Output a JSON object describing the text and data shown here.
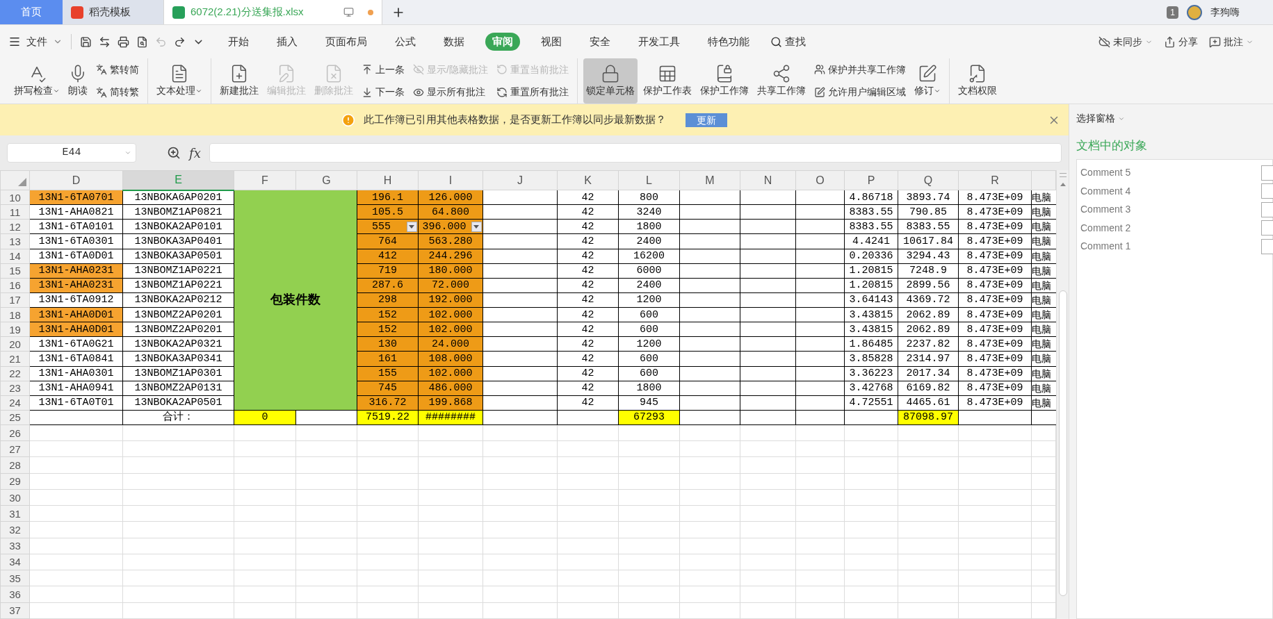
{
  "tabs": [
    {
      "label": "首页",
      "kind": "home",
      "selected": false
    },
    {
      "label": "稻壳模板",
      "kind": "docer",
      "selected": false
    },
    {
      "label": "6072(2.21)分送集报.xlsx",
      "kind": "file",
      "selected": true
    }
  ],
  "account": {
    "badge": "1",
    "user": "李狗嗨"
  },
  "menu": {
    "file": "文件",
    "tabs": [
      {
        "label": "开始",
        "selected": false
      },
      {
        "label": "插入",
        "selected": false
      },
      {
        "label": "页面布局",
        "selected": false
      },
      {
        "label": "公式",
        "selected": false
      },
      {
        "label": "数据",
        "selected": false
      },
      {
        "label": "审阅",
        "selected": true
      },
      {
        "label": "视图",
        "selected": false
      },
      {
        "label": "安全",
        "selected": false
      },
      {
        "label": "开发工具",
        "selected": false
      },
      {
        "label": "特色功能",
        "selected": false
      }
    ],
    "search": "查找",
    "right": [
      "未同步",
      "分享",
      "批注"
    ]
  },
  "ribbon": [
    [
      {
        "kind": "large",
        "label": "拼写检查",
        "dropdown": true,
        "disabled": false,
        "active": false
      },
      {
        "kind": "large",
        "label": "朗读",
        "dropdown": false,
        "disabled": false,
        "active": false
      },
      {
        "kind": "stack",
        "items": [
          {
            "label": "繁转简",
            "disabled": false
          },
          {
            "label": "简转繁",
            "disabled": false
          }
        ]
      }
    ],
    [
      {
        "kind": "large",
        "label": "文本处理",
        "dropdown": true,
        "disabled": false,
        "active": false
      }
    ],
    [
      {
        "kind": "large",
        "label": "新建批注",
        "dropdown": false,
        "disabled": false,
        "active": false
      },
      {
        "kind": "large",
        "label": "编辑批注",
        "dropdown": false,
        "disabled": true,
        "active": false
      },
      {
        "kind": "large",
        "label": "删除批注",
        "dropdown": false,
        "disabled": true,
        "active": false
      },
      {
        "kind": "stack",
        "items": [
          {
            "label": "上一条",
            "disabled": false
          },
          {
            "label": "下一条",
            "disabled": false
          }
        ]
      },
      {
        "kind": "stack",
        "items": [
          {
            "label": "显示/隐藏批注",
            "disabled": true
          },
          {
            "label": "显示所有批注",
            "disabled": false
          }
        ]
      },
      {
        "kind": "stack",
        "items": [
          {
            "label": "重置当前批注",
            "disabled": true
          },
          {
            "label": "重置所有批注",
            "disabled": false
          }
        ]
      }
    ],
    [
      {
        "kind": "large",
        "label": "锁定单元格",
        "dropdown": false,
        "disabled": false,
        "active": true
      },
      {
        "kind": "large",
        "label": "保护工作表",
        "dropdown": false,
        "disabled": false,
        "active": false
      },
      {
        "kind": "large",
        "label": "保护工作簿",
        "dropdown": false,
        "disabled": false,
        "active": false
      },
      {
        "kind": "large",
        "label": "共享工作簿",
        "dropdown": false,
        "disabled": false,
        "active": false
      },
      {
        "kind": "stack",
        "items": [
          {
            "label": "保护并共享工作簿",
            "disabled": false
          },
          {
            "label": "允许用户编辑区域",
            "disabled": false
          }
        ]
      },
      {
        "kind": "large",
        "label": "修订",
        "dropdown": true,
        "disabled": false,
        "active": false
      }
    ],
    [
      {
        "kind": "large",
        "label": "文档权限",
        "dropdown": false,
        "disabled": false,
        "active": false
      }
    ]
  ],
  "notice": {
    "text": "此工作簿已引用其他表格数据，是否更新工作簿以同步最新数据？",
    "button": "更新"
  },
  "name_box": "E44",
  "formula_label": "fx",
  "columns": [
    {
      "label": "D",
      "selected": false
    },
    {
      "label": "E",
      "selected": true
    },
    {
      "label": "F",
      "selected": false
    },
    {
      "label": "G",
      "selected": false
    },
    {
      "label": "H",
      "selected": false
    },
    {
      "label": "I",
      "selected": false
    },
    {
      "label": "J",
      "selected": false
    },
    {
      "label": "K",
      "selected": false
    },
    {
      "label": "L",
      "selected": false
    },
    {
      "label": "M",
      "selected": false
    },
    {
      "label": "N",
      "selected": false
    },
    {
      "label": "O",
      "selected": false
    },
    {
      "label": "P",
      "selected": false
    },
    {
      "label": "Q",
      "selected": false
    },
    {
      "label": "R",
      "selected": false
    }
  ],
  "merged_block": {
    "text": "包装件数",
    "color": "#92d050"
  },
  "rows": [
    {
      "number": "10",
      "kind": "data",
      "cells": {
        "D": {
          "text": "13N1-6TA0701",
          "color": "#f6a330"
        },
        "E": "13NBOKA6AP0201",
        "H": {
          "text": "196.1",
          "color": "#ee9b17"
        },
        "I": {
          "text": "126.000",
          "color": "#ee9b17"
        },
        "K": "42",
        "L": "800",
        "P": "4.86718",
        "Q": "3893.74",
        "R": "8.473E+09",
        "S": "电脑"
      }
    },
    {
      "number": "11",
      "kind": "data",
      "cells": {
        "D": "13N1-AHA0821",
        "E": "13NBOMZ1AP0821",
        "H": {
          "text": "105.5",
          "color": "#ee9b17"
        },
        "I": {
          "text": "64.800",
          "color": "#ee9b17"
        },
        "K": "42",
        "L": "3240",
        "P": "8383.55",
        "Q": "790.85",
        "R": "8.473E+09",
        "S": "电脑"
      }
    },
    {
      "number": "12",
      "kind": "data",
      "cells": {
        "D": "13N1-6TA0101",
        "E": "13NBOKA2AP0101",
        "H": {
          "text": "555",
          "color": "#ee9b17",
          "dropdown": true
        },
        "I": {
          "text": "396.000",
          "color": "#ee9b17",
          "dropdown": true
        },
        "K": "42",
        "L": "1800",
        "P": "8383.55",
        "Q": "8383.55",
        "R": "8.473E+09",
        "S": "电脑"
      }
    },
    {
      "number": "13",
      "kind": "data",
      "cells": {
        "D": "13N1-6TA0301",
        "E": "13NBOKA3AP0401",
        "H": {
          "text": "764",
          "color": "#ee9b17"
        },
        "I": {
          "text": "563.280",
          "color": "#ee9b17"
        },
        "K": "42",
        "L": "2400",
        "P": "4.4241",
        "Q": "10617.84",
        "R": "8.473E+09",
        "S": "电脑"
      }
    },
    {
      "number": "14",
      "kind": "data",
      "cells": {
        "D": "13N1-6TA0D01",
        "E": "13NBOKA3AP0501",
        "H": {
          "text": "412",
          "color": "#ee9b17"
        },
        "I": {
          "text": "244.296",
          "color": "#ee9b17"
        },
        "K": "42",
        "L": "16200",
        "P": "0.20336",
        "Q": "3294.43",
        "R": "8.473E+09",
        "S": "电脑"
      }
    },
    {
      "number": "15",
      "kind": "data",
      "cells": {
        "D": {
          "text": "13N1-AHA0231",
          "color": "#f6a330"
        },
        "E": "13NBOMZ1AP0221",
        "H": {
          "text": "719",
          "color": "#ee9b17"
        },
        "I": {
          "text": "180.000",
          "color": "#ee9b17"
        },
        "K": "42",
        "L": "6000",
        "P": "1.20815",
        "Q": "7248.9",
        "R": "8.473E+09",
        "S": "电脑"
      }
    },
    {
      "number": "16",
      "kind": "data",
      "cells": {
        "D": {
          "text": "13N1-AHA0231",
          "color": "#f6a330"
        },
        "E": "13NBOMZ1AP0221",
        "H": {
          "text": "287.6",
          "color": "#ee9b17"
        },
        "I": {
          "text": "72.000",
          "color": "#ee9b17"
        },
        "K": "42",
        "L": "2400",
        "P": "1.20815",
        "Q": "2899.56",
        "R": "8.473E+09",
        "S": "电脑"
      }
    },
    {
      "number": "17",
      "kind": "data",
      "cells": {
        "D": "13N1-6TA0912",
        "E": "13NBOKA2AP0212",
        "H": {
          "text": "298",
          "color": "#ee9b17"
        },
        "I": {
          "text": "192.000",
          "color": "#ee9b17"
        },
        "K": "42",
        "L": "1200",
        "P": "3.64143",
        "Q": "4369.72",
        "R": "8.473E+09",
        "S": "电脑"
      }
    },
    {
      "number": "18",
      "kind": "data",
      "cells": {
        "D": {
          "text": "13N1-AHA0D01",
          "color": "#f6a330"
        },
        "E": "13NBOMZ2AP0201",
        "H": {
          "text": "152",
          "color": "#ee9b17"
        },
        "I": {
          "text": "102.000",
          "color": "#ee9b17"
        },
        "K": "42",
        "L": "600",
        "P": "3.43815",
        "Q": "2062.89",
        "R": "8.473E+09",
        "S": "电脑"
      }
    },
    {
      "number": "19",
      "kind": "data",
      "cells": {
        "D": {
          "text": "13N1-AHA0D01",
          "color": "#f6a330"
        },
        "E": "13NBOMZ2AP0201",
        "H": {
          "text": "152",
          "color": "#ee9b17"
        },
        "I": {
          "text": "102.000",
          "color": "#ee9b17"
        },
        "K": "42",
        "L": "600",
        "P": "3.43815",
        "Q": "2062.89",
        "R": "8.473E+09",
        "S": "电脑"
      }
    },
    {
      "number": "20",
      "kind": "data",
      "cells": {
        "D": "13N1-6TA0G21",
        "E": "13NBOKA2AP0321",
        "H": {
          "text": "130",
          "color": "#ee9b17"
        },
        "I": {
          "text": "24.000",
          "color": "#ee9b17"
        },
        "K": "42",
        "L": "1200",
        "P": "1.86485",
        "Q": "2237.82",
        "R": "8.473E+09",
        "S": "电脑"
      }
    },
    {
      "number": "21",
      "kind": "data",
      "cells": {
        "D": "13N1-6TA0841",
        "E": "13NBOKA3AP0341",
        "H": {
          "text": "161",
          "color": "#ee9b17"
        },
        "I": {
          "text": "108.000",
          "color": "#ee9b17"
        },
        "K": "42",
        "L": "600",
        "P": "3.85828",
        "Q": "2314.97",
        "R": "8.473E+09",
        "S": "电脑"
      }
    },
    {
      "number": "22",
      "kind": "data",
      "cells": {
        "D": "13N1-AHA0301",
        "E": "13NBOMZ1AP0301",
        "H": {
          "text": "155",
          "color": "#ee9b17"
        },
        "I": {
          "text": "102.000",
          "color": "#ee9b17"
        },
        "K": "42",
        "L": "600",
        "P": "3.36223",
        "Q": "2017.34",
        "R": "8.473E+09",
        "S": "电脑"
      }
    },
    {
      "number": "23",
      "kind": "data",
      "cells": {
        "D": "13N1-AHA0941",
        "E": "13NBOMZ2AP0131",
        "H": {
          "text": "745",
          "color": "#ee9b17"
        },
        "I": {
          "text": "486.000",
          "color": "#ee9b17"
        },
        "K": "42",
        "L": "1800",
        "P": "3.42768",
        "Q": "6169.82",
        "R": "8.473E+09",
        "S": "电脑"
      }
    },
    {
      "number": "24",
      "kind": "data",
      "cells": {
        "D": "13N1-6TA0T01",
        "E": "13NBOKA2AP0501",
        "H": {
          "text": "316.72",
          "color": "#ee9b17"
        },
        "I": {
          "text": "199.868",
          "color": "#ee9b17"
        },
        "K": "42",
        "L": "945",
        "P": "4.72551",
        "Q": "4465.61",
        "R": "8.473E+09",
        "S": "电脑"
      }
    },
    {
      "number": "25",
      "kind": "total",
      "cells": {
        "E": "合计：",
        "F": {
          "text": "0",
          "color": "#ffff00"
        },
        "H": {
          "text": "7519.22",
          "color": "#ffff00"
        },
        "I": {
          "text": "########",
          "color": "#ffff00"
        },
        "L": {
          "text": "67293",
          "color": "#ffff00"
        },
        "Q": {
          "text": "87098.97",
          "color": "#ffff00"
        }
      }
    },
    {
      "number": "26",
      "kind": "empty"
    },
    {
      "number": "27",
      "kind": "empty"
    },
    {
      "number": "28",
      "kind": "empty"
    },
    {
      "number": "29",
      "kind": "empty"
    },
    {
      "number": "30",
      "kind": "empty"
    },
    {
      "number": "31",
      "kind": "empty"
    },
    {
      "number": "32",
      "kind": "empty"
    },
    {
      "number": "33",
      "kind": "empty"
    },
    {
      "number": "34",
      "kind": "empty"
    },
    {
      "number": "35",
      "kind": "empty"
    },
    {
      "number": "36",
      "kind": "empty"
    },
    {
      "number": "37",
      "kind": "empty"
    }
  ],
  "panel": {
    "title": "选择窗格",
    "heading": "文档中的对象",
    "objects": [
      {
        "label": "Comment 5",
        "checked": false
      },
      {
        "label": "Comment 4",
        "checked": false
      },
      {
        "label": "Comment 3",
        "checked": false
      },
      {
        "label": "Comment 2",
        "checked": false
      },
      {
        "label": "Comment 1",
        "checked": false
      }
    ]
  }
}
